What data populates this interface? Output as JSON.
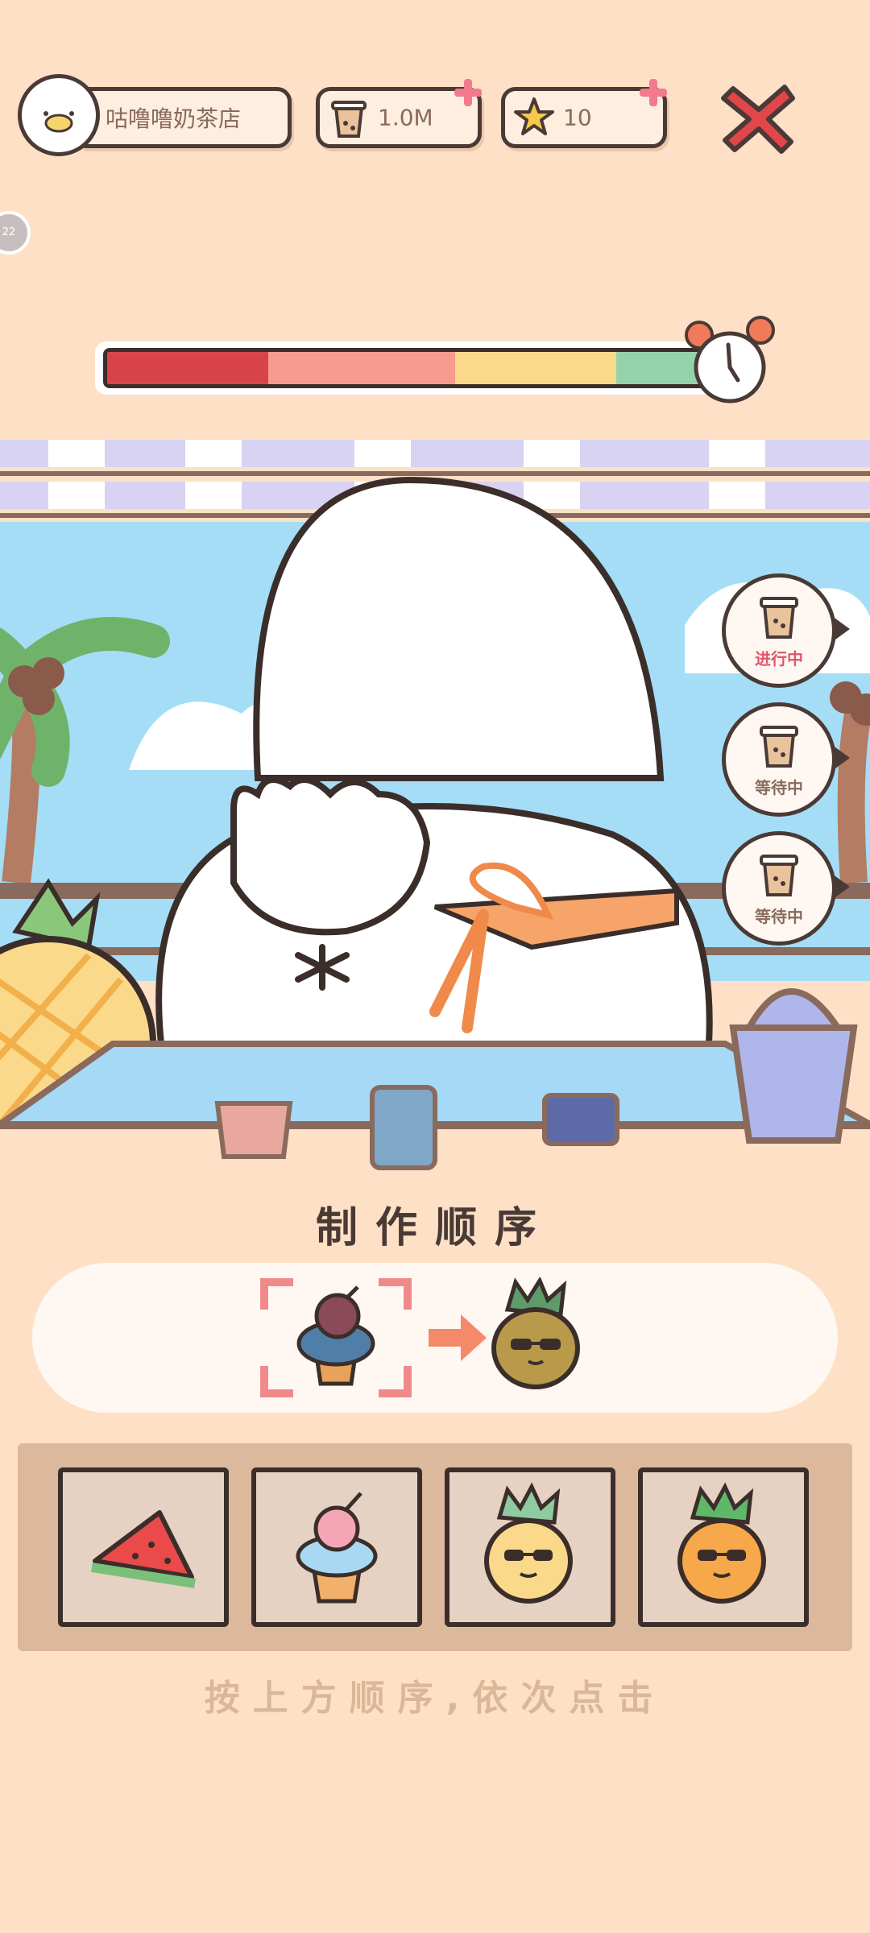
{
  "header": {
    "shop_name": "咕噜噜奶茶店",
    "cups_value": "1.0M",
    "stars_value": "10",
    "side_badge": "22"
  },
  "timer": {
    "segments": [
      "#d9444a",
      "#f69b8f",
      "#fbd98b",
      "#94d3a9"
    ],
    "remaining_fraction": 0.92
  },
  "orders": [
    {
      "status": "进行中"
    },
    {
      "status": "等待中"
    },
    {
      "status": "等待中"
    }
  ],
  "sequence": {
    "title": "制作顺序",
    "steps": [
      "icecream-icon",
      "pineapple-icon"
    ],
    "active_step": 0
  },
  "ingredients": [
    "watermelon-icon",
    "icecream-icon",
    "pineapple-icon",
    "pineapple-icon"
  ],
  "instruction": "按上方顺序,依次点击",
  "colors": {
    "background": "#fde0c6",
    "accent_red": "#e0464a",
    "pink_plus": "#f27a8c"
  }
}
